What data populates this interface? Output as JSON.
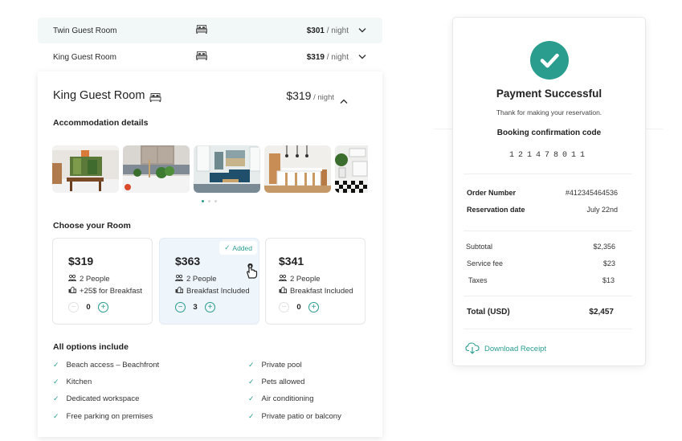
{
  "rooms": [
    {
      "name": "Twin Guest Room",
      "price": "$301",
      "unit": " / night",
      "icon": "bed-icon",
      "expanded": false
    },
    {
      "name": "King Guest Room",
      "price": "$319",
      "unit": " / night",
      "icon": "bed-icon",
      "expanded": false
    }
  ],
  "detail": {
    "title": "King Guest Room",
    "price": "$319",
    "unit": " / night",
    "accommodation_label": "Accommodation details",
    "photos": [
      "dining room",
      "kitchen sink",
      "living room",
      "kitchen island",
      "bathroom"
    ],
    "carousel": {
      "pages": 3,
      "active": 1
    },
    "choose_label": "Choose your Room",
    "options": [
      {
        "price": "$319",
        "people": "2 People",
        "breakfast": "+25$ for Breakfast",
        "quantity": "0",
        "selected": false
      },
      {
        "price": "$363",
        "people": "2 People",
        "breakfast": "Breakfast Included",
        "quantity": "3",
        "selected": true,
        "badge": "Added"
      },
      {
        "price": "$341",
        "people": "2 People",
        "breakfast": "Breakfast Included",
        "quantity": "0",
        "selected": false
      }
    ],
    "stepper": {
      "minus": "−",
      "plus": "+"
    },
    "amenities_label": "All options include",
    "amenities_left": [
      "Beach access – Beachfront",
      "Kitchen",
      "Dedicated workspace",
      "Free parking on premises"
    ],
    "amenities_right": [
      "Private pool",
      "Pets allowed",
      "Air conditioning",
      "Private patio or balcony"
    ],
    "check_glyph": "✓"
  },
  "receipt": {
    "title": "Payment Successful",
    "subtitle": "Thank for making your reservation.",
    "code_label": "Booking confirmation code",
    "code": "121478011",
    "order_label": "Order Number",
    "order_value": "#412345464536",
    "date_label": "Reservation date",
    "date_value": "July 22nd",
    "subtotal_label": "Subtotal",
    "subtotal_value": "$2,356",
    "fee_label": "Service fee",
    "fee_value": "$23",
    "taxes_label": "Taxes",
    "taxes_value": "$13",
    "total_label": "Total (USD)",
    "total_value": "$2,457",
    "download_label": "Download Receipt"
  },
  "colors": {
    "accent": "#2a9d8f",
    "selected_bg": "#eef5fb",
    "row_highlight": "#f2f8f8"
  }
}
